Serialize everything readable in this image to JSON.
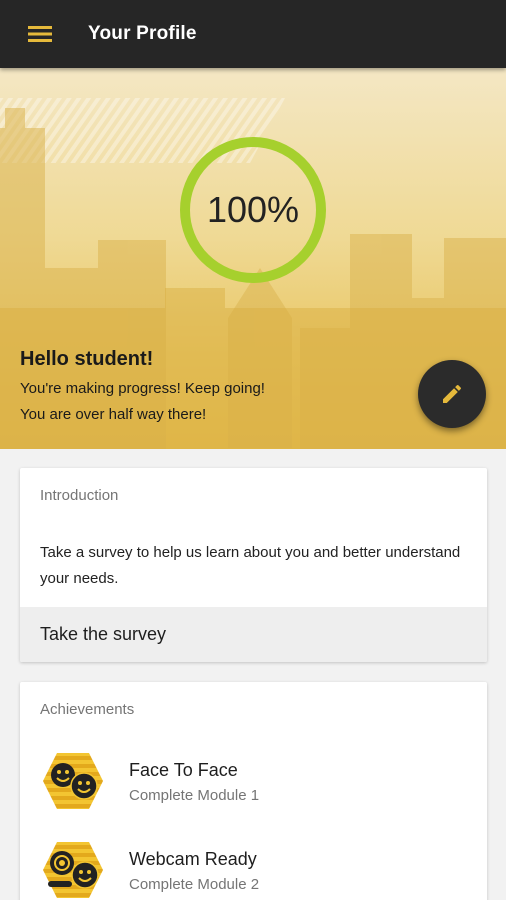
{
  "appbar": {
    "title": "Your Profile",
    "menu_icon": "hamburger-menu-icon"
  },
  "hero": {
    "progress_label": "100%",
    "progress_fraction": 1.0,
    "ring_color": "#a6d02d",
    "greeting": "Hello student!",
    "message_line1": "You're making progress! Keep going!",
    "message_line2": "You are over half way there!",
    "edit_icon": "pencil-icon",
    "accent_color": "#e4bd4f"
  },
  "intro_card": {
    "header": "Introduction",
    "body": "Take a survey to help us learn about you and better understand your needs.",
    "button_label": "Take the survey"
  },
  "achievements_card": {
    "header": "Achievements",
    "items": [
      {
        "title": "Face To Face",
        "subtitle": "Complete Module 1",
        "icon": "two-smiley-faces-badge-icon"
      },
      {
        "title": "Webcam Ready",
        "subtitle": "Complete Module 2",
        "icon": "webcam-smiley-badge-icon"
      }
    ]
  }
}
